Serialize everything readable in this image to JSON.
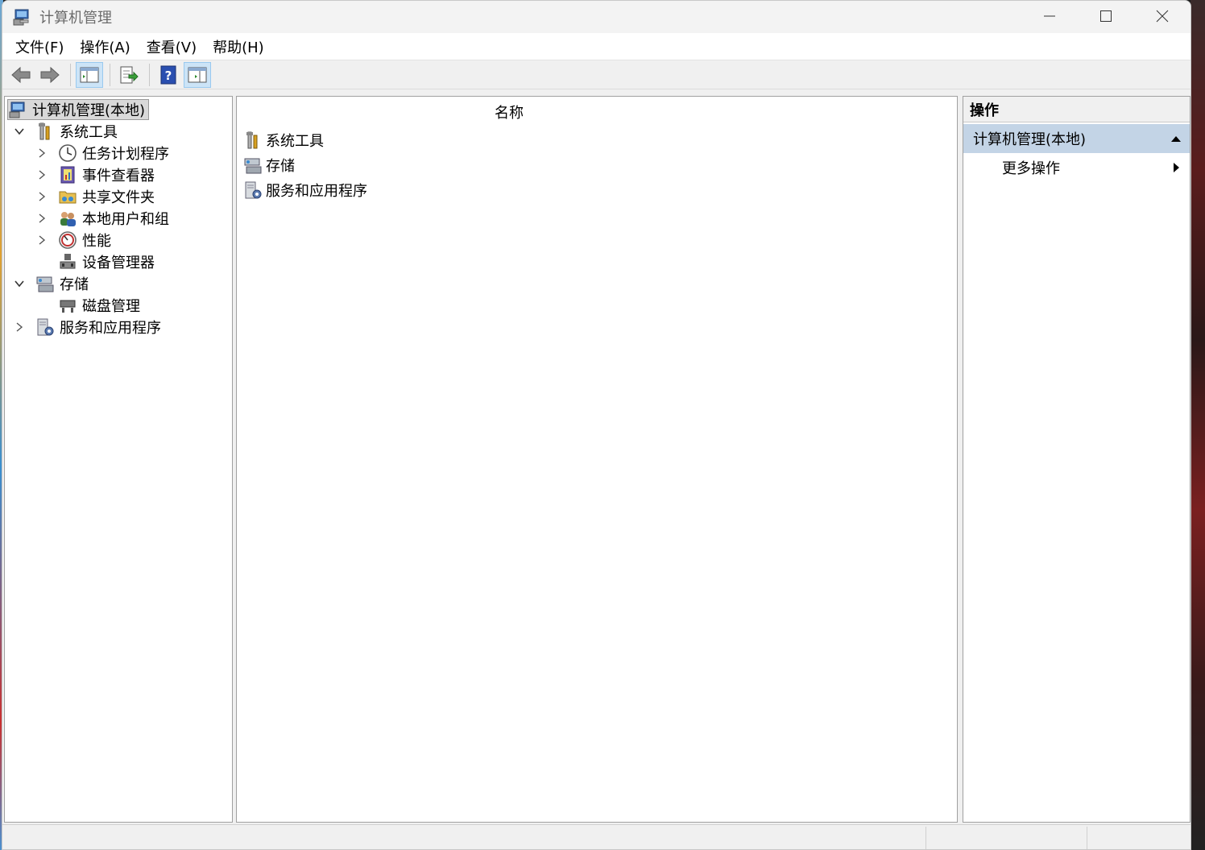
{
  "window": {
    "title": "计算机管理"
  },
  "menu": [
    "文件(F)",
    "操作(A)",
    "查看(V)",
    "帮助(H)"
  ],
  "toolbar": {
    "buttons": [
      "back-arrow-icon",
      "forward-arrow-icon",
      "show-hide-tree-icon",
      "export-list-icon",
      "help-icon",
      "show-hide-action-pane-icon"
    ]
  },
  "tree": {
    "root": "计算机管理(本地)",
    "system_tools": "系统工具",
    "task_scheduler": "任务计划程序",
    "event_viewer": "事件查看器",
    "shared_folders": "共享文件夹",
    "local_users": "本地用户和组",
    "performance": "性能",
    "device_manager": "设备管理器",
    "storage": "存储",
    "disk_management": "磁盘管理",
    "services_apps": "服务和应用程序"
  },
  "center": {
    "column_header": "名称",
    "items": [
      "系统工具",
      "存储",
      "服务和应用程序"
    ]
  },
  "actions": {
    "header": "操作",
    "group": "计算机管理(本地)",
    "more": "更多操作"
  }
}
